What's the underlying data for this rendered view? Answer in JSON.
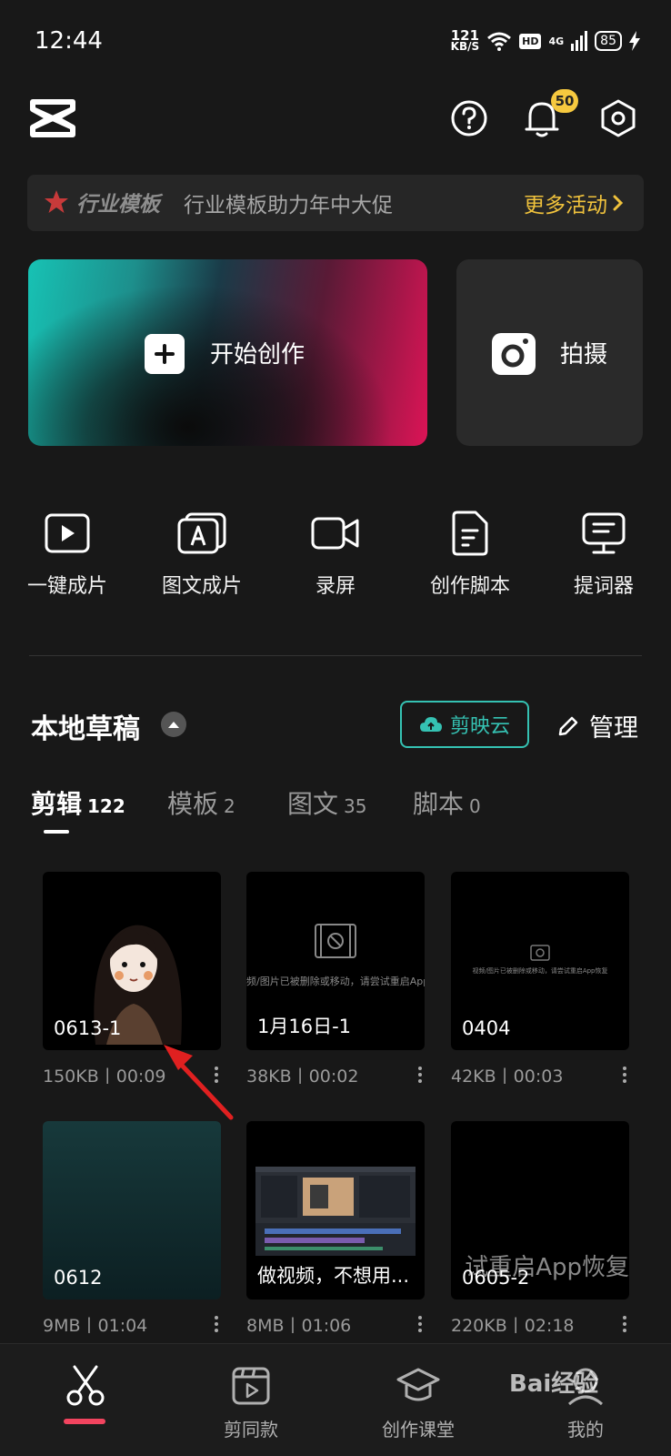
{
  "status_bar": {
    "time": "12:44",
    "net_speed": "121",
    "net_unit": "KB/S",
    "hd": "HD",
    "network": "4G",
    "battery": "85"
  },
  "header": {
    "logo_icon": "capcut-logo-icon",
    "notifications_count": "50"
  },
  "promo": {
    "tag": "行业模板",
    "text": "行业模板助力年中大促",
    "more": "更多活动"
  },
  "create": {
    "start_label": "开始创作",
    "shoot_label": "拍摄"
  },
  "tools": [
    {
      "label": "一键成片",
      "icon": "play-video-icon"
    },
    {
      "label": "图文成片",
      "icon": "text-to-video-icon"
    },
    {
      "label": "录屏",
      "icon": "video-camera-icon"
    },
    {
      "label": "创作脚本",
      "icon": "script-document-icon"
    },
    {
      "label": "提词器",
      "icon": "teleprompter-icon"
    }
  ],
  "drafts": {
    "title": "本地草稿",
    "cloud_label": "剪映云",
    "manage_label": "管理",
    "tabs": [
      {
        "label": "剪辑",
        "count": "122",
        "active": true
      },
      {
        "label": "模板",
        "count": "2",
        "active": false
      },
      {
        "label": "图文",
        "count": "35",
        "active": false
      },
      {
        "label": "脚本",
        "count": "0",
        "active": false
      }
    ],
    "items": [
      {
        "name": "0613-1",
        "meta": "150KB丨00:09"
      },
      {
        "name": "1月16日-1",
        "meta": "38KB丨00:02",
        "overlay": "频/图片已被删除或移动，请尝试重启App"
      },
      {
        "name": "0404",
        "meta": "42KB丨00:03",
        "overlay": "视频/图片已被删除或移动，请尝试重启App恢复"
      },
      {
        "name": "0612",
        "meta": "9MB丨01:04"
      },
      {
        "name": "做视频，不想用...",
        "meta": "8MB丨01:06"
      },
      {
        "name": "0605-2",
        "meta": "220KB丨02:18",
        "overlay": "试重启App恢复"
      }
    ]
  },
  "bottom_nav": [
    {
      "label": "",
      "icon": "scissors-icon",
      "active": true
    },
    {
      "label": "剪同款",
      "icon": "template-play-icon",
      "active": false
    },
    {
      "label": "创作课堂",
      "icon": "graduation-cap-icon",
      "active": false
    },
    {
      "label": "我的",
      "icon": "profile-icon",
      "active": false
    }
  ],
  "watermark": "Bai经验",
  "colors": {
    "accent_teal": "#35c2b3",
    "promo_gold": "#f0c23c",
    "nav_active": "#f2445f",
    "badge_yellow": "#f6c93f"
  }
}
